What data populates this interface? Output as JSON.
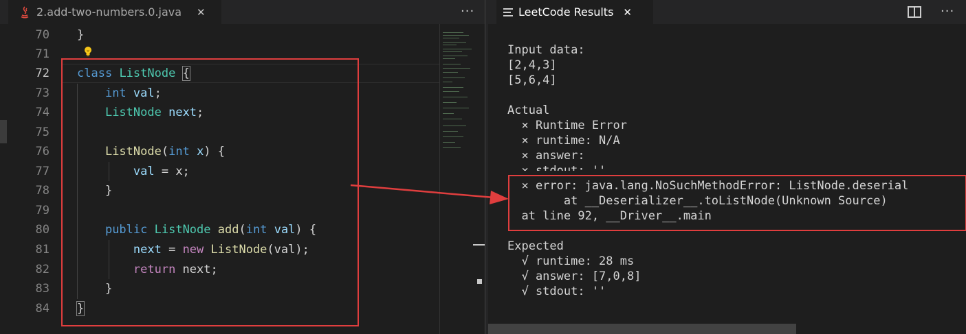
{
  "editor": {
    "tab_label": "2.add-two-numbers.0.java",
    "tab_close": "✕",
    "more_actions": "···",
    "line_numbers": [
      "70",
      "71",
      "72",
      "73",
      "74",
      "75",
      "76",
      "77",
      "78",
      "79",
      "80",
      "81",
      "82",
      "83",
      "84"
    ],
    "code": {
      "l70": "}",
      "l72_kw": "class",
      "l72_type": "ListNode",
      "l72_brace": "{",
      "l73_kw": "int",
      "l73_var": "val",
      "l73_semi": ";",
      "l74_type": "ListNode",
      "l74_var": "next",
      "l74_semi": ";",
      "l76_fn": "ListNode",
      "l76_paren": "(",
      "l76_kw": "int",
      "l76_var": "x",
      "l76_rest": ") {",
      "l77_var": "val",
      "l77_rest": " = x;",
      "l78": "}",
      "l80_kw": "public",
      "l80_type": "ListNode",
      "l80_fn": "add",
      "l80_paren": "(",
      "l80_kw2": "int",
      "l80_var": "val",
      "l80_rest": ") {",
      "l81_var": "next",
      "l81_eq": " = ",
      "l81_new": "new",
      "l81_fn": "ListNode",
      "l81_rest": "(val);",
      "l82_kw": "return",
      "l82_rest": " next;",
      "l83": "}",
      "l84": "}"
    }
  },
  "results": {
    "tab_label": "LeetCode Results",
    "tab_close": "✕",
    "more_actions": "···",
    "lines": [
      "Input data:",
      "[2,4,3]",
      "[5,6,4]",
      "",
      "Actual",
      "  × Runtime Error",
      "  × runtime: N/A",
      "  × answer:",
      "  × stdout: ''",
      "  × error: java.lang.NoSuchMethodError: ListNode.deserial",
      "        at __Deserializer__.toListNode(Unknown Source)",
      "  at line 92, __Driver__.main",
      "",
      "Expected",
      "  √ runtime: 28 ms",
      "  √ answer: [7,0,8]",
      "  √ stdout: ''"
    ]
  },
  "colors": {
    "annotation_red": "#e03e3e",
    "keyword_blue": "#569cd6",
    "type_teal": "#4ec9b0"
  }
}
